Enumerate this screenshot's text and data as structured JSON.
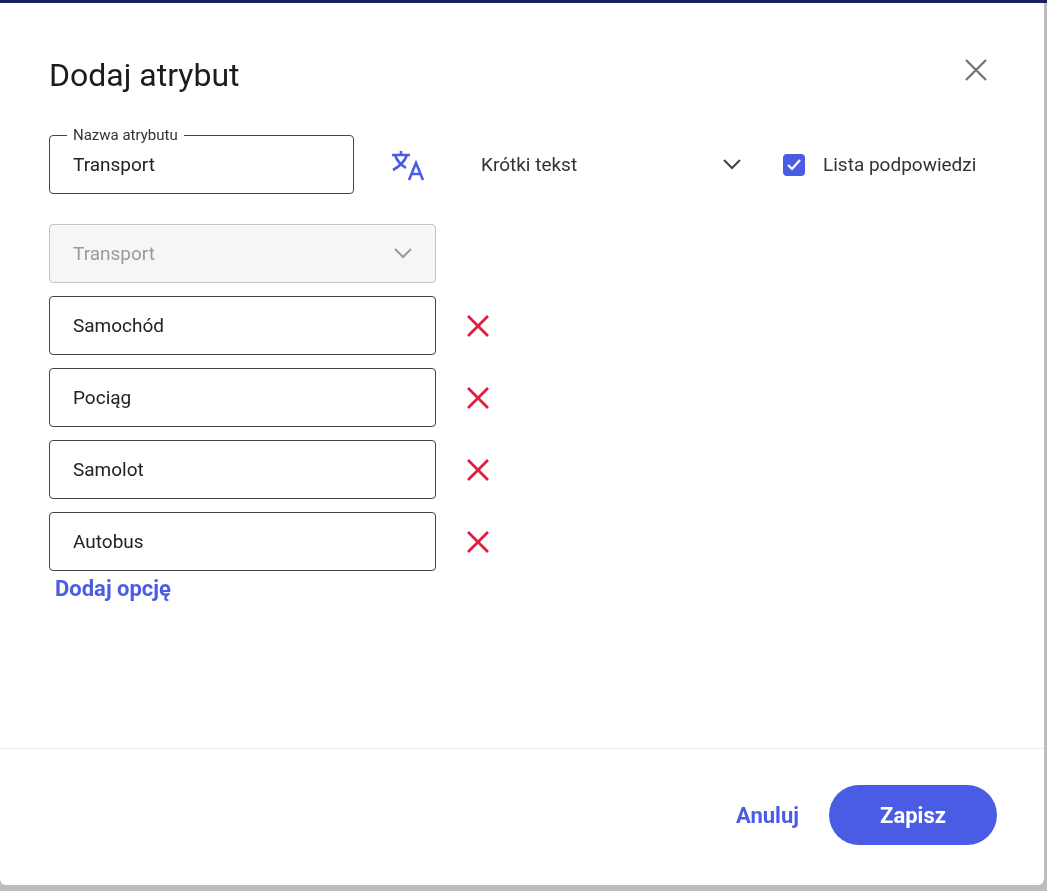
{
  "dialog": {
    "title": "Dodaj atrybut"
  },
  "name_field": {
    "label": "Nazwa atrybutu",
    "value": "Transport"
  },
  "type_select": {
    "value": "Krótki tekst"
  },
  "suggestions_checkbox": {
    "label": "Lista podpowiedzi",
    "checked": true
  },
  "list_select": {
    "value": "Transport",
    "disabled": true
  },
  "options": [
    {
      "value": "Samochód"
    },
    {
      "value": "Pociąg"
    },
    {
      "value": "Samolot"
    },
    {
      "value": "Autobus"
    }
  ],
  "add_option_link": "Dodaj opcję",
  "buttons": {
    "cancel": "Anuluj",
    "save": "Zapisz"
  }
}
